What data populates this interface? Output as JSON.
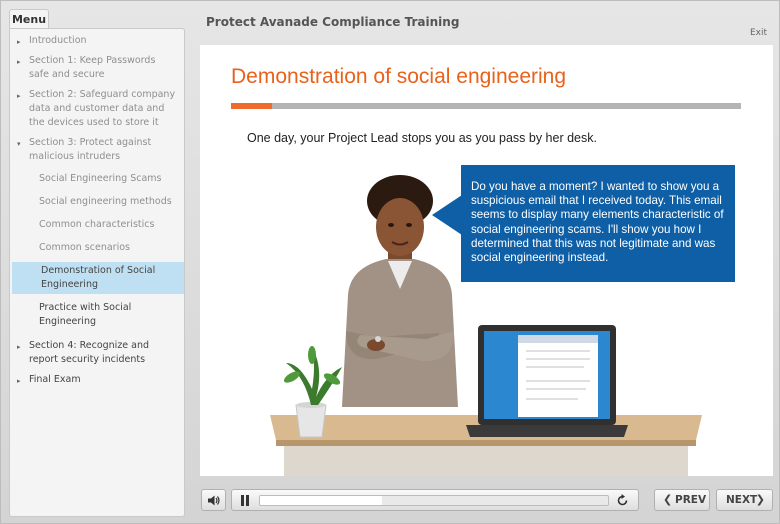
{
  "header": {
    "course_title": "Protect Avanade Compliance Training",
    "exit_label": "Exit"
  },
  "sidebar": {
    "tab_label": "Menu",
    "items": [
      {
        "label": "Introduction",
        "arrow": "▸"
      },
      {
        "label": "Section 1: Keep Passwords safe and secure",
        "arrow": "▸"
      },
      {
        "label": "Section 2: Safeguard company data and customer data and the devices used to store it",
        "arrow": "▸"
      },
      {
        "label": "Section 3: Protect against malicious intruders",
        "arrow": "▾"
      },
      {
        "label": "Social Engineering Scams"
      },
      {
        "label": "Social engineering methods"
      },
      {
        "label": "Common characteristics"
      },
      {
        "label": "Common scenarios"
      },
      {
        "label": "Demonstration of Social Engineering"
      },
      {
        "label": "Practice with Social Engineering"
      },
      {
        "label": "Section 4: Recognize and report security incidents",
        "arrow": "▸"
      },
      {
        "label": "Final Exam",
        "arrow": "▸"
      }
    ]
  },
  "slide": {
    "title": "Demonstration of social engineering",
    "intro": "One day, your Project Lead stops you as you pass by her desk.",
    "bubble_text": "Do you have a moment? I wanted to show you a suspicious email that I received today. This email seems to display many elements characteristic of social engineering scams. I'll show you how I determined that this was not legitimate and was social engineering instead.",
    "title_progress": 0.08
  },
  "controls": {
    "playback_progress": 0.35,
    "prev_label": "PREV",
    "next_label": "NEXT"
  },
  "icons": {
    "volume": "speaker-icon",
    "pause": "pause-icon",
    "replay": "replay-icon",
    "prev": "chevron-left-icon",
    "next": "chevron-right-icon"
  },
  "colors": {
    "title_orange": "#e8621c",
    "bubble_blue": "#0f5fa6",
    "selected_item": "#bfe0f2"
  }
}
